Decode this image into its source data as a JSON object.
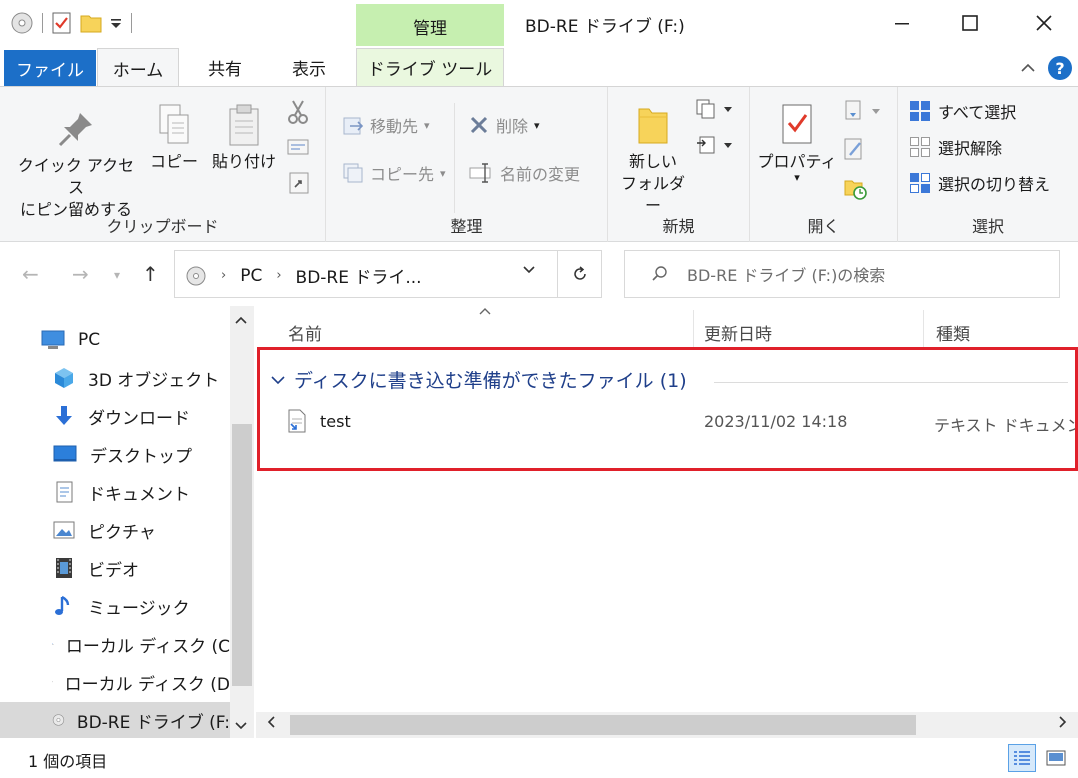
{
  "window": {
    "title": "BD-RE ドライブ (F:)",
    "context_tab_header": "管理",
    "minimize": "—",
    "maximize": "☐",
    "close": "✕"
  },
  "ribbon_tabs": {
    "file": "ファイル",
    "home": "ホーム",
    "share": "共有",
    "view": "表示",
    "drive_tools": "ドライブ ツール"
  },
  "ribbon": {
    "clipboard": {
      "label": "クリップボード",
      "pin": "クイック アクセス\nにピン留めする",
      "copy": "コピー",
      "paste": "貼り付け"
    },
    "organize": {
      "label": "整理",
      "move_to": "移動先",
      "copy_to": "コピー先",
      "delete": "削除",
      "rename": "名前の変更"
    },
    "new": {
      "label": "新規",
      "new_folder": "新しい\nフォルダー"
    },
    "open": {
      "label": "開く",
      "properties": "プロパティ"
    },
    "select": {
      "label": "選択",
      "select_all": "すべて選択",
      "select_none": "選択解除",
      "invert": "選択の切り替え"
    }
  },
  "address": {
    "crumbs": [
      "PC",
      "BD-RE ドライ..."
    ],
    "search_placeholder": "BD-RE ドライブ (F:)の検索"
  },
  "nav": {
    "items": [
      {
        "label": "PC",
        "icon": "pc-icon"
      },
      {
        "label": "3D オブジェクト",
        "icon": "3d-objects-icon"
      },
      {
        "label": "ダウンロード",
        "icon": "download-icon"
      },
      {
        "label": "デスクトップ",
        "icon": "desktop-icon"
      },
      {
        "label": "ドキュメント",
        "icon": "documents-icon"
      },
      {
        "label": "ピクチャ",
        "icon": "pictures-icon"
      },
      {
        "label": "ビデオ",
        "icon": "video-icon"
      },
      {
        "label": "ミュージック",
        "icon": "music-icon"
      },
      {
        "label": "ローカル ディスク (C",
        "icon": "local-disk-c-icon"
      },
      {
        "label": "ローカル ディスク (D",
        "icon": "local-disk-d-icon"
      },
      {
        "label": "BD-RE ドライブ (F:",
        "icon": "bd-drive-icon"
      }
    ]
  },
  "list": {
    "columns": {
      "name": "名前",
      "modified": "更新日時",
      "type": "種類"
    },
    "group_title": "ディスクに書き込む準備ができたファイル (1)",
    "files": [
      {
        "name": "test",
        "modified": "2023/11/02 14:18",
        "type": "テキスト ドキュメント"
      }
    ]
  },
  "status": {
    "count": "1 個の項目"
  },
  "colors": {
    "file_tab": "#1c6fc8",
    "context_tab": "#c6efb0",
    "highlight_box": "#e0202a",
    "group_title": "#1f3f8a"
  }
}
